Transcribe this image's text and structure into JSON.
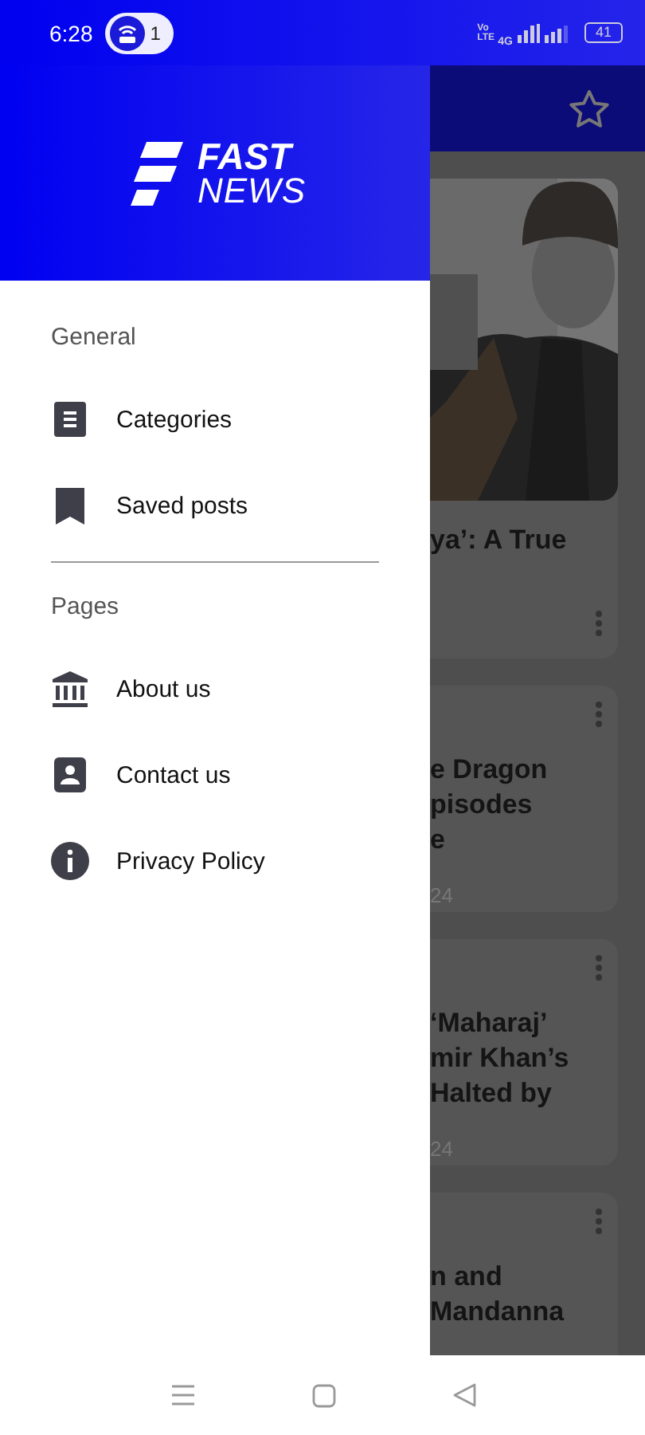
{
  "status_bar": {
    "time": "6:28",
    "hotspot_count": "1",
    "volte": "Vo LTE",
    "network": "4G",
    "battery": "41"
  },
  "drawer": {
    "logo": {
      "line_1": "FAST",
      "line_2": "NEWS"
    },
    "sections": [
      {
        "title": "General",
        "items": [
          {
            "label": "Categories",
            "kind": "list"
          },
          {
            "label": "Saved posts",
            "kind": "bookmark"
          }
        ]
      },
      {
        "title": "Pages",
        "items": [
          {
            "label": "About us",
            "kind": "bank"
          },
          {
            "label": "Contact us",
            "kind": "contact"
          },
          {
            "label": "Privacy Policy",
            "kind": "info"
          }
        ]
      }
    ]
  },
  "feed": {
    "cards": [
      {
        "image": {
          "kind": "picture"
        },
        "title_lines": [
          "ya’: A True"
        ]
      },
      {
        "title_lines": [
          "e Dragon",
          "pisodes",
          "e"
        ],
        "date": "24"
      },
      {
        "title_lines": [
          "‘Maharaj’",
          "mir Khan’s",
          "Halted by"
        ],
        "date": "24"
      },
      {
        "title_lines": [
          "n and",
          "Mandanna"
        ]
      }
    ]
  }
}
